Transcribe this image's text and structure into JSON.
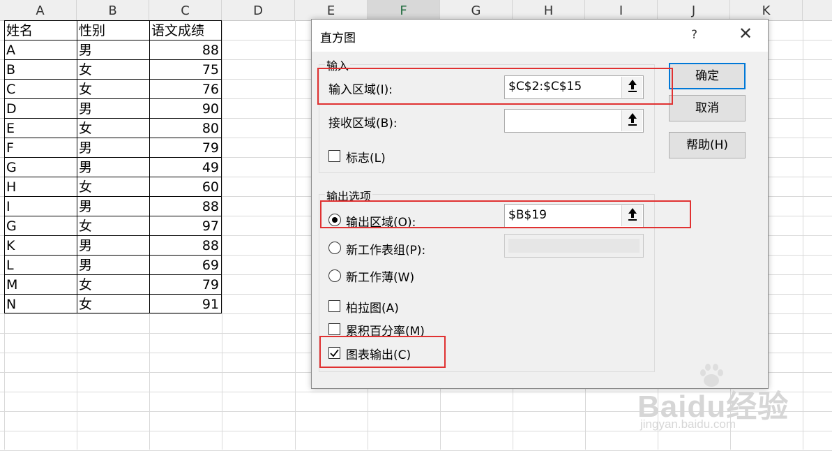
{
  "columns": [
    "A",
    "B",
    "C",
    "D",
    "E",
    "F",
    "G",
    "H",
    "I",
    "J",
    "K"
  ],
  "selected_column": "F",
  "table": {
    "headers": [
      "姓名",
      "性别",
      "语文成绩"
    ],
    "rows": [
      [
        "A",
        "男",
        "88"
      ],
      [
        "B",
        "女",
        "75"
      ],
      [
        "C",
        "女",
        "76"
      ],
      [
        "D",
        "男",
        "90"
      ],
      [
        "E",
        "女",
        "80"
      ],
      [
        "F",
        "男",
        "79"
      ],
      [
        "G",
        "男",
        "49"
      ],
      [
        "H",
        "女",
        "60"
      ],
      [
        "I",
        "男",
        "88"
      ],
      [
        "G",
        "女",
        "97"
      ],
      [
        "K",
        "男",
        "88"
      ],
      [
        "L",
        "男",
        "69"
      ],
      [
        "M",
        "女",
        "79"
      ],
      [
        "N",
        "女",
        "91"
      ]
    ]
  },
  "dialog": {
    "title": "直方图",
    "help_glyph": "?",
    "close_glyph": "✕",
    "input_group": {
      "label": "输入",
      "input_range_label": "输入区域(I):",
      "input_range_value": "$C$2:$C$15",
      "bin_range_label": "接收区域(B):",
      "bin_range_value": "",
      "labels_checkbox": "标志(L)",
      "labels_checked": false
    },
    "output_group": {
      "label": "输出选项",
      "output_range_label": "输出区域(O):",
      "output_range_value": "$B$19",
      "new_sheet_label": "新工作表组(P):",
      "new_workbook_label": "新工作薄(W)",
      "pareto_label": "柏拉图(A)",
      "pareto_checked": false,
      "cumulative_label": "累积百分率(M)",
      "cumulative_checked": false,
      "chart_output_label": "图表输出(C)",
      "chart_output_checked": true
    },
    "buttons": {
      "ok": "确定",
      "cancel": "取消",
      "help": "帮助(H)"
    }
  },
  "watermark": {
    "brand": "Baidu经验",
    "url": "jingyan.baidu.com"
  },
  "colors": {
    "highlight": "#e03131",
    "default_button_border": "#0078d7",
    "selected_column_text": "#217346"
  }
}
